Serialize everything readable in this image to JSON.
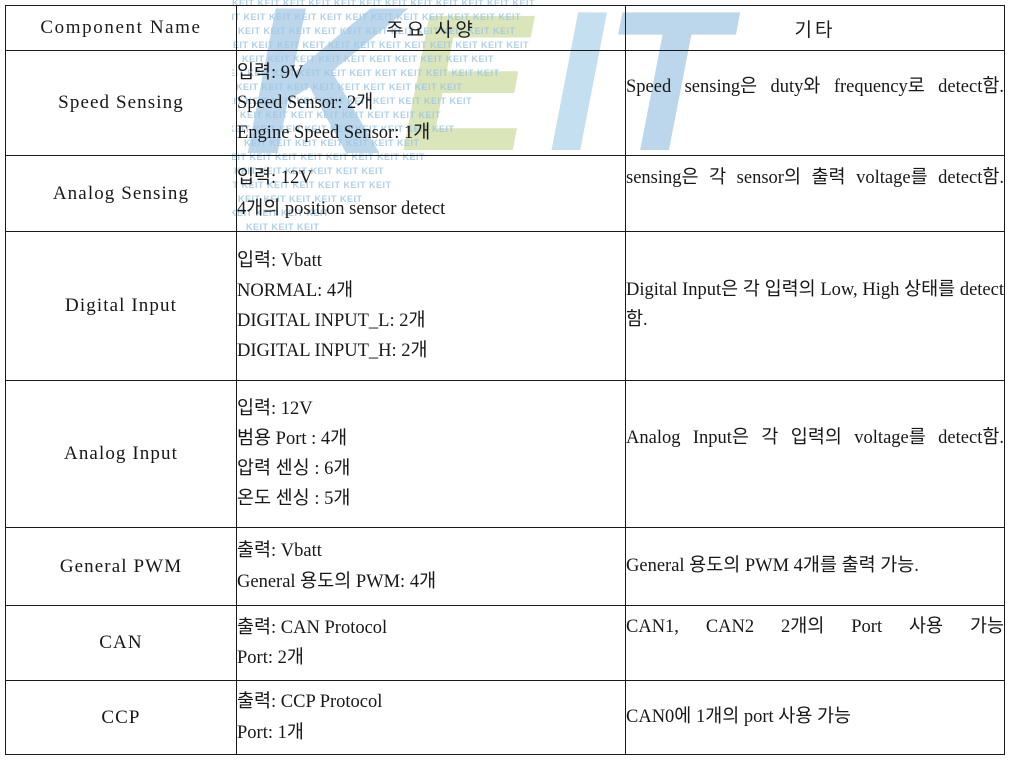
{
  "watermark": {
    "logo_text": "KEIT",
    "tile_text": "KEIT",
    "colors": {
      "blue": "#7fb3da",
      "green": "#b9cf7a",
      "tile": "#9fc8e6"
    }
  },
  "table": {
    "headers": [
      {
        "label": "Component Name"
      },
      {
        "label": "주요 사양"
      },
      {
        "label": "기타"
      }
    ],
    "rows": [
      {
        "name": "Speed Sensing",
        "spec": [
          "입력: 9V",
          "Speed Sensor: 2개",
          "Engine Speed Sensor: 1개"
        ],
        "etc": "Speed sensing은 duty와 frequency로 detect함."
      },
      {
        "name": "Analog Sensing",
        "spec": [
          "입력: 12V",
          "4개의 position sensor detect"
        ],
        "etc": "sensing은 각 sensor의 출력 voltage를 detect함."
      },
      {
        "name": "Digital Input",
        "spec": [
          "입력: Vbatt",
          "NORMAL: 4개",
          "DIGITAL INPUT_L: 2개",
          "DIGITAL INPUT_H: 2개"
        ],
        "etc": "Digital Input은 각 입력의 Low, High 상태를 detect함."
      },
      {
        "name": "Analog Input",
        "spec": [
          "입력: 12V",
          "범용 Port : 4개",
          "압력 센싱 : 6개",
          "온도 센싱 : 5개"
        ],
        "etc": "Analog Input은 각 입력의 voltage를 detect함."
      },
      {
        "name": "General PWM",
        "spec": [
          "출력: Vbatt",
          "General 용도의 PWM: 4개"
        ],
        "etc": "General 용도의 PWM 4개를 출력 가능."
      },
      {
        "name": "CAN",
        "spec": [
          "출력: CAN Protocol",
          "Port: 2개"
        ],
        "etc": "CAN1, CAN2 2개의 Port 사용 가능"
      },
      {
        "name": "CCP",
        "spec": [
          "출력: CCP Protocol",
          "Port: 1개"
        ],
        "etc": "CAN0에 1개의 port 사용 가능"
      }
    ]
  }
}
